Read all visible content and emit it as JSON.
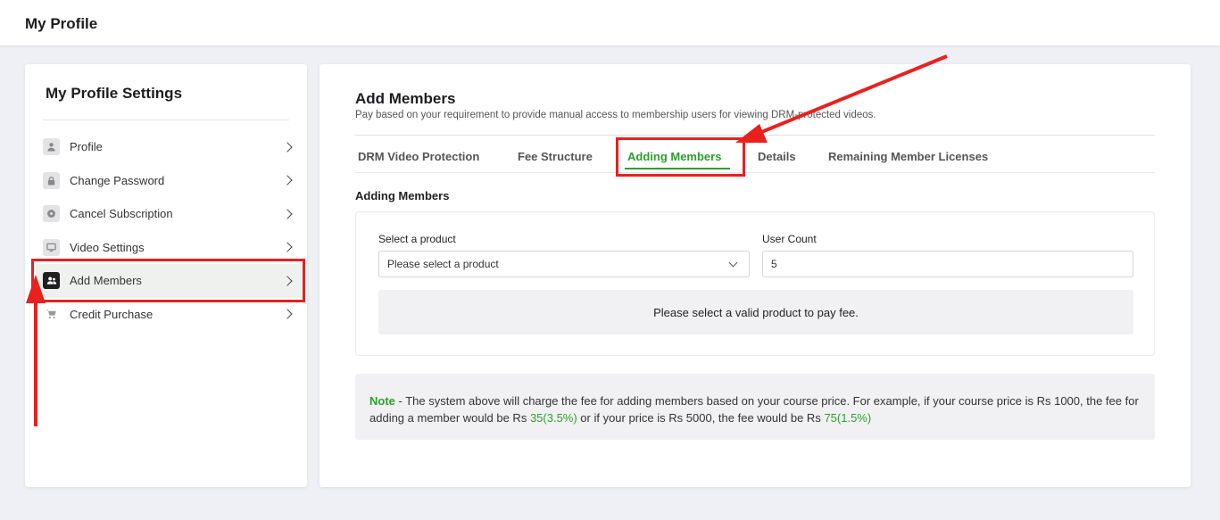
{
  "header": {
    "title": "My Profile"
  },
  "sidebar": {
    "title": "My Profile Settings",
    "items": [
      {
        "label": "Profile",
        "icon": "user-icon"
      },
      {
        "label": "Change Password",
        "icon": "lock-icon"
      },
      {
        "label": "Cancel Subscription",
        "icon": "cancel-circle-icon"
      },
      {
        "label": "Video Settings",
        "icon": "monitor-icon"
      },
      {
        "label": "Add Members",
        "icon": "users-icon",
        "active": true
      },
      {
        "label": "Credit Purchase",
        "icon": "cart-icon"
      }
    ]
  },
  "main": {
    "title": "Add Members",
    "subtitle": "Pay based on your requirement to provide manual access to membership users for viewing DRM-protected videos.",
    "tabs": [
      {
        "label": "DRM Video Protection"
      },
      {
        "label": "Fee Structure"
      },
      {
        "label": "Adding Members",
        "active": true
      },
      {
        "label": "Details"
      },
      {
        "label": "Remaining Member Licenses"
      }
    ],
    "section_title": "Adding Members",
    "form": {
      "product_label": "Select a product",
      "product_value": "Please select a product",
      "count_label": "User Count",
      "count_value": "5",
      "fee_message": "Please select a valid product to pay fee."
    },
    "note": {
      "label": "Note",
      "text_1": " - The system above will charge the fee for adding members based on your course price. For example, if your course price is Rs 1000, the fee for adding a member would be Rs ",
      "fee_1": "35(3.5%)",
      "text_2": " or if your price is Rs 5000, the fee would be Rs ",
      "fee_2": "75(1.5%)"
    }
  },
  "colors": {
    "accent_green": "#2ca02c",
    "annotation_red": "#e8211f",
    "background": "#eff0f5"
  }
}
